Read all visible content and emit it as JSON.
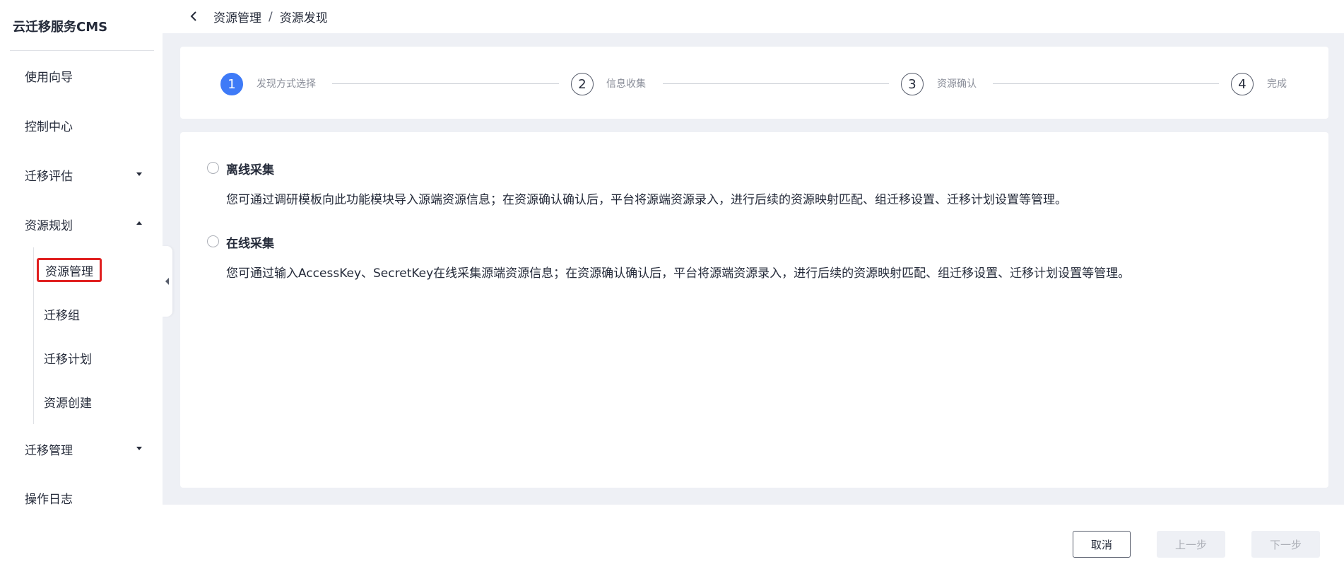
{
  "sidebar": {
    "brand": "云迁移服务CMS",
    "items": [
      {
        "label": "使用向导"
      },
      {
        "label": "控制中心"
      },
      {
        "label": "迁移评估"
      },
      {
        "label": "资源规划"
      },
      {
        "label": "迁移管理"
      },
      {
        "label": "操作日志"
      }
    ],
    "sub_items": [
      {
        "label": "资源管理",
        "active": true
      },
      {
        "label": "迁移组"
      },
      {
        "label": "迁移计划"
      },
      {
        "label": "资源创建"
      }
    ]
  },
  "breadcrumb": {
    "parent": "资源管理",
    "separator": "/",
    "current": "资源发现"
  },
  "steps": [
    {
      "number": "1",
      "label": "发现方式选择",
      "active": true
    },
    {
      "number": "2",
      "label": "信息收集"
    },
    {
      "number": "3",
      "label": "资源确认"
    },
    {
      "number": "4",
      "label": "完成"
    }
  ],
  "options": [
    {
      "title": "离线采集",
      "description": "您可通过调研模板向此功能模块导入源端资源信息；在资源确认确认后，平台将源端资源录入，进行后续的资源映射匹配、组迁移设置、迁移计划设置等管理。"
    },
    {
      "title": "在线采集",
      "description": "您可通过输入AccessKey、SecretKey在线采集源端资源信息；在资源确认确认后，平台将源端资源录入，进行后续的资源映射匹配、组迁移设置、迁移计划设置等管理。"
    }
  ],
  "footer": {
    "cancel": "取消",
    "prev": "上一步",
    "next": "下一步"
  },
  "colors": {
    "accent": "#3e7af7",
    "highlight_border": "#e02020",
    "page_bg": "#eef0f5"
  }
}
